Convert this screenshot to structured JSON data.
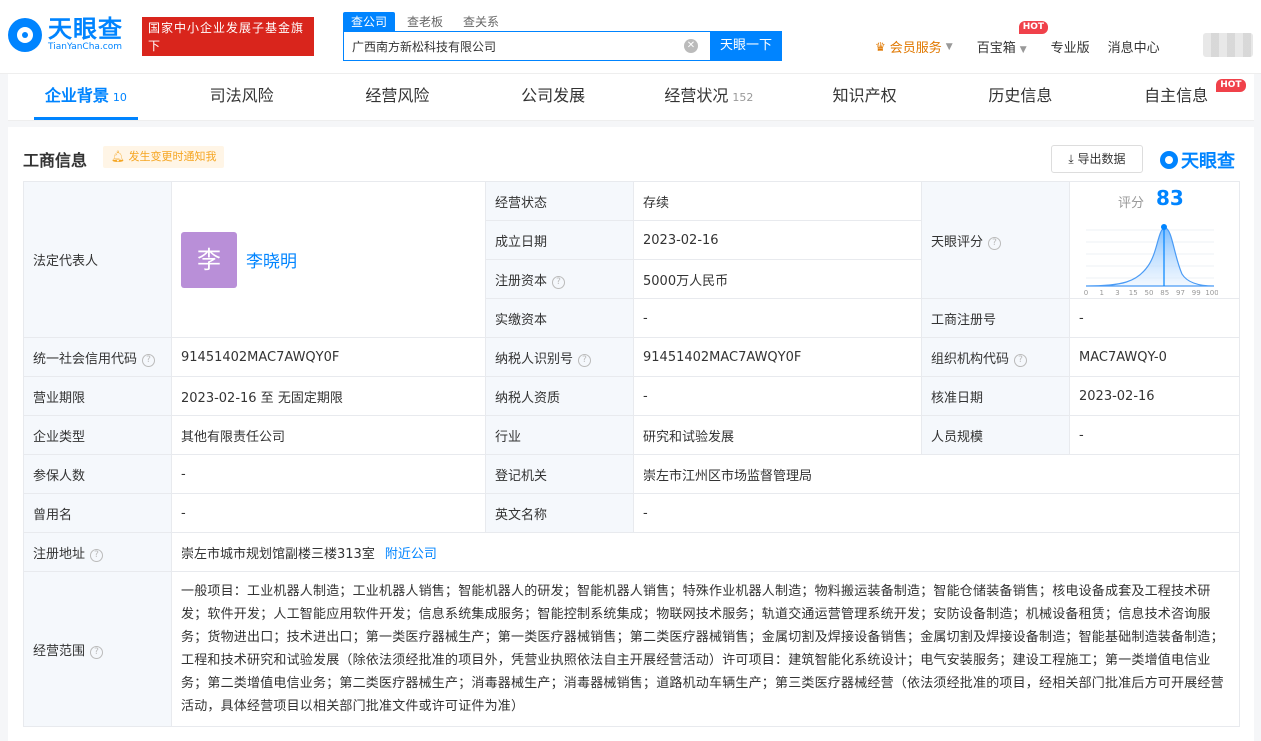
{
  "header": {
    "logo_cn": "天眼查",
    "logo_en": "TianYanCha.com",
    "gov_badge_line1": "国家中小企业发展子基金旗下",
    "gov_badge_line2": "官方备案企业征信机构",
    "search_tabs": [
      "查公司",
      "查老板",
      "查关系"
    ],
    "search_value": "广西南方新松科技有限公司",
    "search_button": "天眼一下",
    "nav": {
      "vip": "会员服务",
      "treasure": "百宝箱",
      "hot": "HOT",
      "pro": "专业版",
      "messages": "消息中心"
    }
  },
  "tabs": [
    {
      "label": "企业背景",
      "count": "10"
    },
    {
      "label": "司法风险",
      "count": ""
    },
    {
      "label": "经营风险",
      "count": ""
    },
    {
      "label": "公司发展",
      "count": ""
    },
    {
      "label": "经营状况",
      "count": "152"
    },
    {
      "label": "知识产权",
      "count": ""
    },
    {
      "label": "历史信息",
      "count": ""
    },
    {
      "label": "自主信息",
      "count": ""
    }
  ],
  "tab_hot": "HOT",
  "section": {
    "title": "工商信息",
    "notify": "发生变更时通知我",
    "export": "导出数据",
    "logo": "天眼查"
  },
  "info": {
    "legal_rep_label": "法定代表人",
    "legal_rep_avatar": "李",
    "legal_rep_name": "李晓明",
    "status_label": "经营状态",
    "status": "存续",
    "founded_label": "成立日期",
    "founded": "2023-02-16",
    "capital_label": "注册资本",
    "capital": "5000万人民币",
    "paid_label": "实缴资本",
    "paid": "-",
    "score_label": "天眼评分",
    "score_title": "评分",
    "score": "83",
    "score_ticks": [
      "0",
      "1",
      "3",
      "15",
      "50",
      "85",
      "97",
      "99",
      "100"
    ],
    "biz_reg_label": "工商注册号",
    "biz_reg": "-",
    "credit_code_label": "统一社会信用代码",
    "credit_code": "91451402MAC7AWQY0F",
    "taxpayer_id_label": "纳税人识别号",
    "taxpayer_id": "91451402MAC7AWQY0F",
    "org_code_label": "组织机构代码",
    "org_code": "MAC7AWQY-0",
    "term_label": "营业期限",
    "term": "2023-02-16 至 无固定期限",
    "taxpayer_qual_label": "纳税人资质",
    "taxpayer_qual": "-",
    "approved_label": "核准日期",
    "approved": "2023-02-16",
    "type_label": "企业类型",
    "type": "其他有限责任公司",
    "industry_label": "行业",
    "industry": "研究和试验发展",
    "staff_label": "人员规模",
    "staff": "-",
    "insured_label": "参保人数",
    "insured": "-",
    "authority_label": "登记机关",
    "authority": "崇左市江州区市场监督管理局",
    "former_name_label": "曾用名",
    "former_name": "-",
    "english_label": "英文名称",
    "english": "-",
    "address_label": "注册地址",
    "address": "崇左市城市规划馆副楼三楼313室",
    "nearby": "附近公司",
    "scope_label": "经营范围",
    "scope": "一般项目：工业机器人制造；工业机器人销售；智能机器人的研发；智能机器人销售；特殊作业机器人制造；物料搬运装备制造；智能仓储装备销售；核电设备成套及工程技术研发；软件开发；人工智能应用软件开发；信息系统集成服务；智能控制系统集成；物联网技术服务；轨道交通运营管理系统开发；安防设备制造；机械设备租赁；信息技术咨询服务；货物进出口；技术进出口；第一类医疗器械生产；第一类医疗器械销售；第二类医疗器械销售；金属切割及焊接设备销售；金属切割及焊接设备制造；智能基础制造装备制造；工程和技术研究和试验发展（除依法须经批准的项目外，凭营业执照依法自主开展经营活动）许可项目：建筑智能化系统设计；电气安装服务；建设工程施工；第一类增值电信业务；第二类增值电信业务；第二类医疗器械生产；消毒器械生产；消毒器械销售；道路机动车辆生产；第三类医疗器械经营（依法须经批准的项目，经相关部门批准后方可开展经营活动，具体经营项目以相关部门批准文件或许可证件为准）"
  },
  "colors": {
    "brand": "#0084ff",
    "gov_red": "#d9251c",
    "vip": "#e07800",
    "hot": "#f0414a",
    "avatar": "#b98fd8"
  }
}
